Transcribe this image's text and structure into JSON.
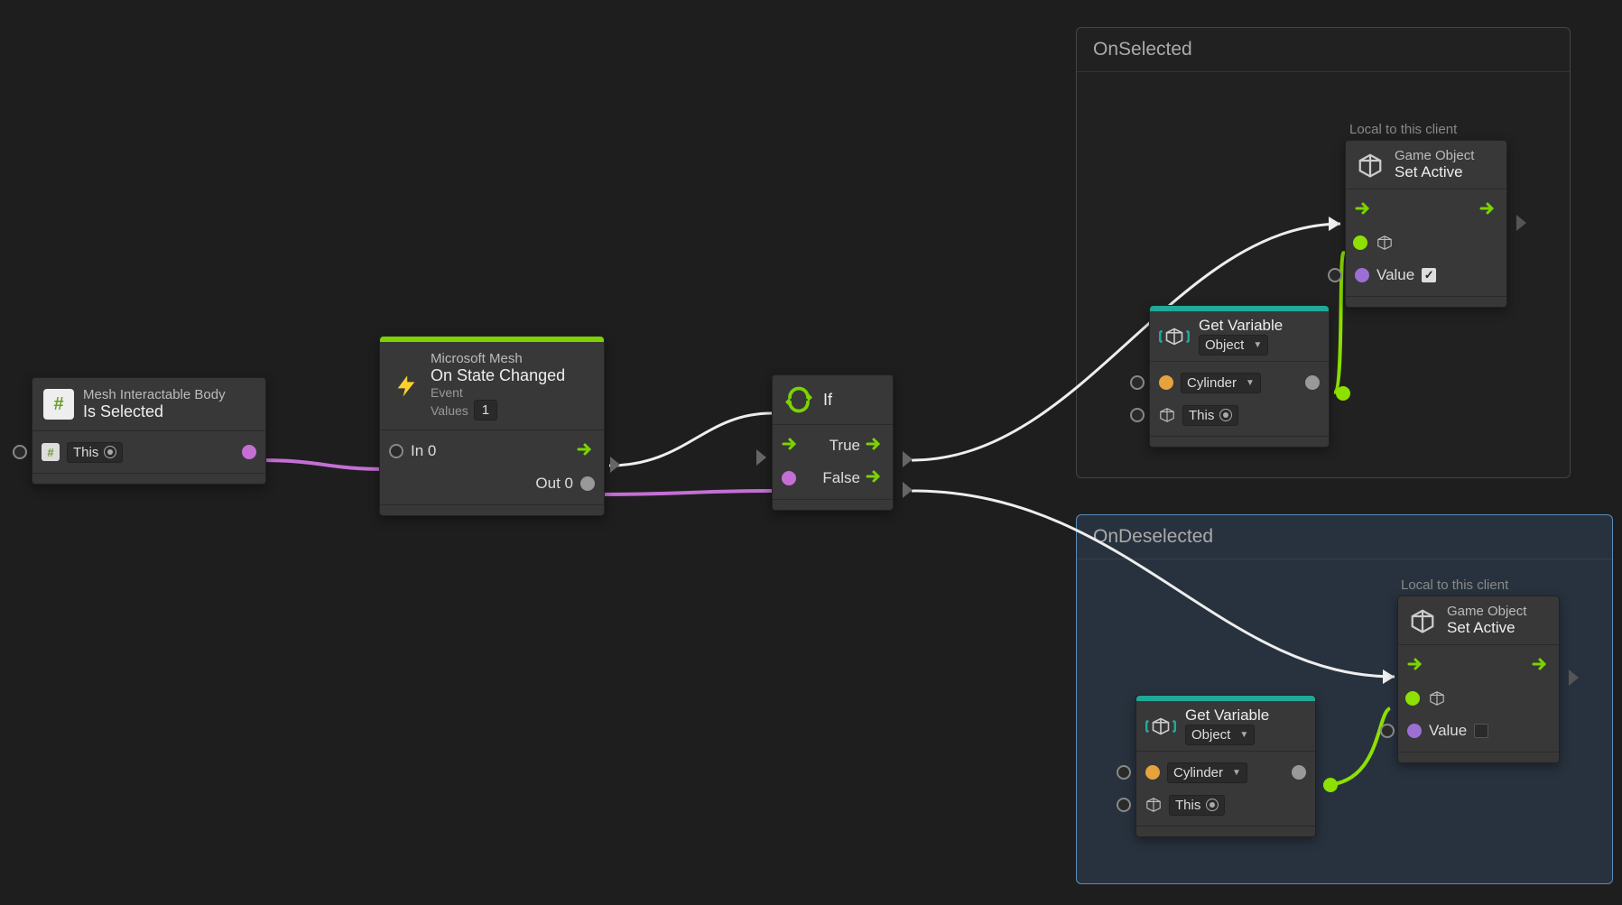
{
  "groups": {
    "onSelected": {
      "title": "OnSelected"
    },
    "onDeselected": {
      "title": "OnDeselected"
    }
  },
  "notes": {
    "localTop": "Local to this client",
    "localBottom": "Local to this client"
  },
  "nodes": {
    "isSelected": {
      "subtitle": "Mesh Interactable Body",
      "title": "Is Selected",
      "target": "This"
    },
    "onStateChanged": {
      "subtitle": "Microsoft Mesh",
      "title": "On State Changed",
      "eventLabel": "Event",
      "valuesLabel": "Values",
      "valuesCount": "1",
      "in0": "In 0",
      "out0": "Out 0"
    },
    "ifNode": {
      "title": "If",
      "true": "True",
      "false": "False"
    },
    "getVar1": {
      "title": "Get Variable",
      "scope": "Object",
      "var": "Cylinder",
      "target": "This"
    },
    "getVar2": {
      "title": "Get Variable",
      "scope": "Object",
      "var": "Cylinder",
      "target": "This"
    },
    "setActive1": {
      "subtitle": "Game Object",
      "title": "Set Active",
      "value": "Value"
    },
    "setActive2": {
      "subtitle": "Game Object",
      "title": "Set Active",
      "value": "Value"
    }
  }
}
